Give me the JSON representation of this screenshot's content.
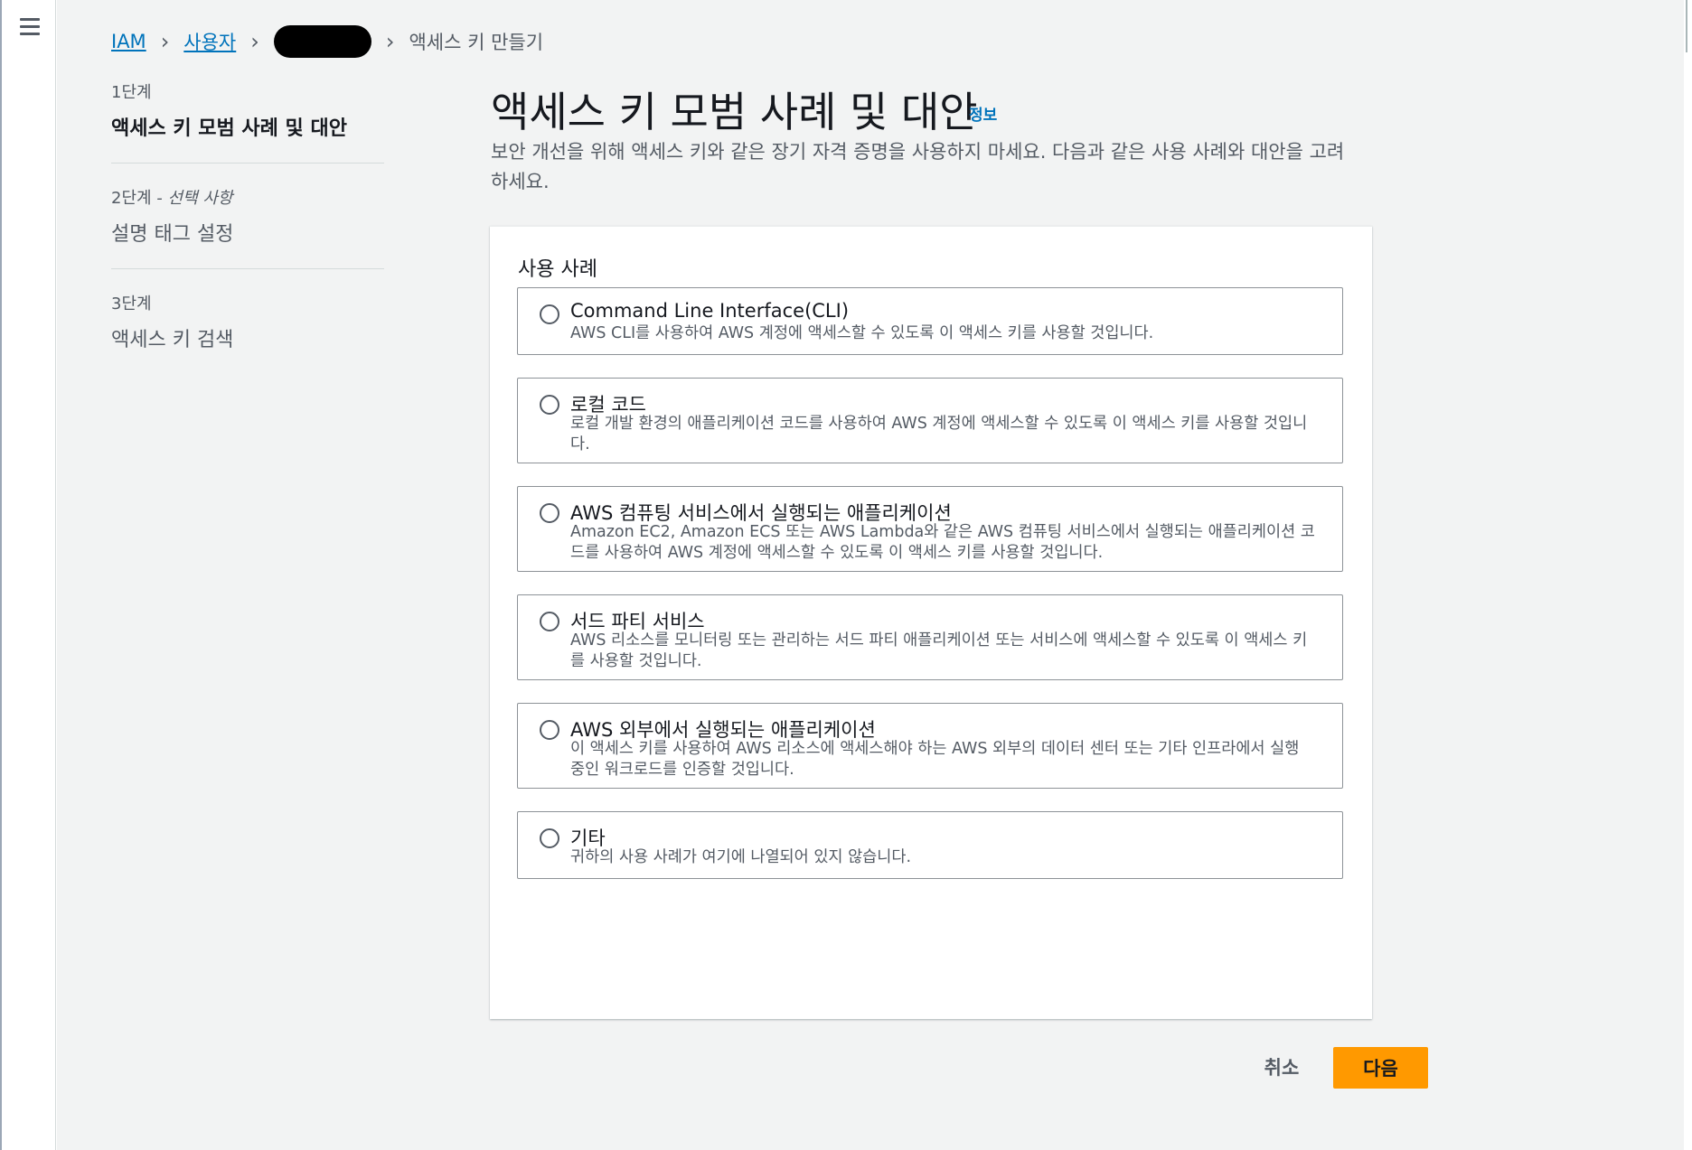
{
  "breadcrumb": {
    "iam": "IAM",
    "users": "사용자",
    "current": "액세스 키 만들기"
  },
  "steps": [
    {
      "number": "1단계",
      "optional": "",
      "title": "액세스 키 모범 사례 및 대안"
    },
    {
      "number": "2단계",
      "optional": " - 선택 사항",
      "title": "설명 태그 설정"
    },
    {
      "number": "3단계",
      "optional": "",
      "title": "액세스 키 검색"
    }
  ],
  "header": {
    "title": "액세스 키 모범 사례 및 대안",
    "info": "정보",
    "description": "보안 개선을 위해 액세스 키와 같은 장기 자격 증명을 사용하지 마세요. 다음과 같은 사용 사례와 대안을 고려하세요."
  },
  "use_cases": {
    "title": "사용 사례",
    "options": [
      {
        "label": "Command Line Interface(CLI)",
        "description": "AWS CLI를 사용하여 AWS 계정에 액세스할 수 있도록 이 액세스 키를 사용할 것입니다.",
        "selected": false
      },
      {
        "label": "로컬 코드",
        "description": "로컬 개발 환경의 애플리케이션 코드를 사용하여 AWS 계정에 액세스할 수 있도록 이 액세스 키를 사용할 것입니다.",
        "selected": false
      },
      {
        "label": "AWS 컴퓨팅 서비스에서 실행되는 애플리케이션",
        "description": "Amazon EC2, Amazon ECS 또는 AWS Lambda와 같은 AWS 컴퓨팅 서비스에서 실행되는 애플리케이션 코드를 사용하여 AWS 계정에 액세스할 수 있도록 이 액세스 키를 사용할 것입니다.",
        "selected": false
      },
      {
        "label": "서드 파티 서비스",
        "description": "AWS 리소스를 모니터링 또는 관리하는 서드 파티 애플리케이션 또는 서비스에 액세스할 수 있도록 이 액세스 키를 사용할 것입니다.",
        "selected": false
      },
      {
        "label": "AWS 외부에서 실행되는 애플리케이션",
        "description": "이 액세스 키를 사용하여 AWS 리소스에 액세스해야 하는 AWS 외부의 데이터 센터 또는 기타 인프라에서 실행 중인 워크로드를 인증할 것입니다.",
        "selected": false
      },
      {
        "label": "기타",
        "description": "귀하의 사용 사례가 여기에 나열되어 있지 않습니다.",
        "selected": false
      }
    ]
  },
  "actions": {
    "cancel": "취소",
    "next": "다음"
  },
  "colors": {
    "primary_button": "#ff9900",
    "link": "#0073bb",
    "background": "#f2f3f3"
  }
}
